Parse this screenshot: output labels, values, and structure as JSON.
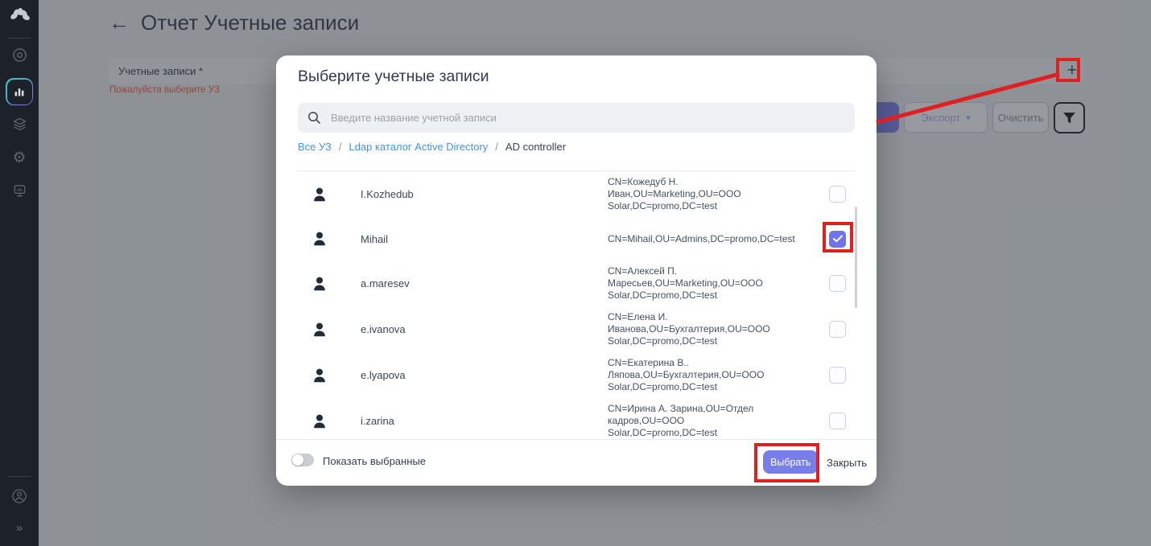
{
  "colors": {
    "accent_indigo": "#787ee9",
    "annotation_red": "#e02020",
    "link_blue": "#4394e8",
    "sidebar_bg": "#1d222a",
    "checkbox_checked": "#6f75e8"
  },
  "sidebar": {
    "collapse_label": "»"
  },
  "page": {
    "back_arrow": "←",
    "title": "Отчет Учетные записи",
    "accounts_field": {
      "label": "Учетные записи *",
      "error": "Пожалуйста выберите УЗ",
      "add_label": "+"
    },
    "toolbar": {
      "export_label": "Экспорт",
      "export_caret": "▾",
      "clear_label": "Очистить"
    }
  },
  "modal": {
    "title": "Выберите учетные записи",
    "search_placeholder": "Введите название учетной записи",
    "breadcrumb_separator": "/",
    "breadcrumbs": [
      {
        "label": "Все УЗ",
        "link": true
      },
      {
        "label": "Ldap каталог Active Directory",
        "link": true
      },
      {
        "label": "AD controller",
        "link": false
      }
    ],
    "accounts": [
      {
        "name": "I.Kozhedub",
        "dn": "CN=Кожедуб Н. Иван,OU=Marketing,OU=ООО Solar,DC=promo,DC=test",
        "checked": false
      },
      {
        "name": "Mihail",
        "dn": "CN=Mihail,OU=Admins,DC=promo,DC=test",
        "checked": true
      },
      {
        "name": "a.maresev",
        "dn": "CN=Алексей П. Маресьев,OU=Marketing,OU=ООО Solar,DC=promo,DC=test",
        "checked": false
      },
      {
        "name": "e.ivanova",
        "dn": "CN=Елена И. Иванова,OU=Бухгалтерия,OU=ООО Solar,DC=promo,DC=test",
        "checked": false
      },
      {
        "name": "e.lyapova",
        "dn": "CN=Екатерина В.. Ляпова,OU=Бухгалтерия,OU=ООО Solar,DC=promo,DC=test",
        "checked": false
      },
      {
        "name": "i.zarina",
        "dn": "CN=Ирина А. Зарина,OU=Отдел кадров,OU=ООО Solar,DC=promo,DC=test",
        "checked": false
      }
    ],
    "footer": {
      "toggle_label": "Показать выбранные",
      "toggle_on": false,
      "select_label": "Выбрать",
      "close_label": "Закрыть"
    }
  }
}
